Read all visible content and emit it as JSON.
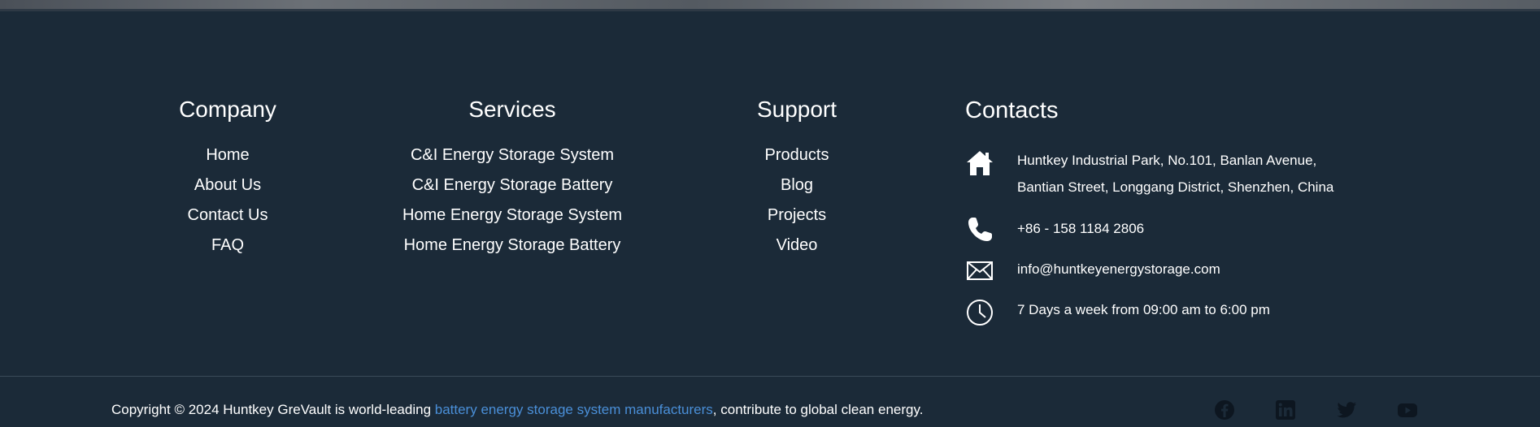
{
  "footer": {
    "company": {
      "title": "Company",
      "links": [
        "Home",
        "About Us",
        "Contact Us",
        "FAQ"
      ]
    },
    "services": {
      "title": "Services",
      "links": [
        "C&I Energy Storage System",
        "C&I Energy Storage Battery",
        "Home Energy Storage System",
        "Home Energy Storage Battery"
      ]
    },
    "support": {
      "title": "Support",
      "links": [
        "Products",
        "Blog",
        "Projects",
        "Video"
      ]
    },
    "contacts": {
      "title": "Contacts",
      "address_line1": "Huntkey Industrial Park, No.101, Banlan Avenue,",
      "address_line2": "Bantian Street, Longgang District, Shenzhen, China",
      "phone": "+86 - 158 1184 2806",
      "email": "info@huntkeyenergystorage.com",
      "hours": "7 Days a week from 09:00 am to 6:00 pm",
      "icons": [
        "home-icon",
        "phone-icon",
        "envelope-icon",
        "clock-icon"
      ]
    },
    "bottom": {
      "copyright_prefix": "Copyright © 2024 Huntkey  GreVault is world-leading ",
      "copyright_link": "battery energy storage system manufacturers",
      "copyright_suffix": ", contribute to global clean energy.",
      "link_color": "#4a8fd8",
      "social_icons": [
        "facebook-icon",
        "linkedin-icon",
        "twitter-icon",
        "youtube-icon"
      ]
    },
    "colors": {
      "background": "#1b2a38",
      "text": "#ffffff",
      "social": "#0d1620"
    }
  }
}
